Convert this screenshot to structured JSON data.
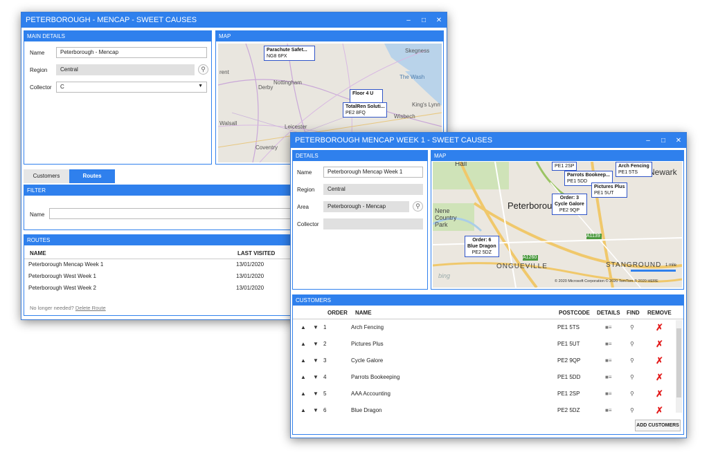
{
  "win1": {
    "title": "PETERBOROUGH - MENCAP - SWEET CAUSES",
    "main_details": {
      "header": "MAIN DETAILS",
      "name_label": "Name",
      "name_value": "Peterborough - Mencap",
      "region_label": "Region",
      "region_value": "Central",
      "collector_label": "Collector",
      "collector_value": "C"
    },
    "map": {
      "header": "MAP",
      "pins": [
        {
          "line1": "Parachute Safet...",
          "line2": "NG8 6PX"
        },
        {
          "line1": "Floor 4 U",
          "line2": ""
        },
        {
          "line1": "TotalRen Soluti...",
          "line2": "PE2 8FQ"
        }
      ],
      "places": [
        "Skegness",
        "rent",
        "Derby",
        "Nottingham",
        "The Wash",
        "King's Lynn",
        "Wisbech",
        "Walsall",
        "Leicester",
        "Coventry"
      ]
    },
    "tabs": [
      "Customers",
      "Routes"
    ],
    "filter": {
      "header": "FILTER",
      "name_label": "Name"
    },
    "routes": {
      "header": "ROUTES",
      "col_name": "NAME",
      "col_last": "LAST VISITED",
      "rows": [
        {
          "name": "Peterborough Mencap Week 1",
          "date": "13/01/2020"
        },
        {
          "name": "Peterborough West Week 1",
          "date": "13/01/2020"
        },
        {
          "name": "Peterborough West Week 2",
          "date": "13/01/2020"
        }
      ],
      "footer_text": "No longer needed?",
      "footer_link": "Delete Route"
    }
  },
  "win2": {
    "title": "PETERBOROUGH MENCAP WEEK 1 - SWEET CAUSES",
    "details": {
      "header": "DETAILS",
      "name_label": "Name",
      "name_value": "Peterborough Mencap Week 1",
      "region_label": "Region",
      "region_value": "Central",
      "area_label": "Area",
      "area_value": "Peterborough - Mencap",
      "collector_label": "Collector",
      "collector_value": ""
    },
    "map": {
      "header": "MAP",
      "pins": [
        {
          "line1": "PE1 2SP",
          "line2": ""
        },
        {
          "line1": "Parrots Bookeep...",
          "line2": "PE1 5DD"
        },
        {
          "line1": "Arch Fencing",
          "line2": "PE1 5TS"
        },
        {
          "line1": "Pictures Plus",
          "line2": "PE1 5UT"
        },
        {
          "line1": "Order: 3",
          "line2": "Cycle Galore",
          "line3": "PE2 9QP"
        },
        {
          "line1": "Order: 6",
          "line2": "Blue Dragon",
          "line3": "PE2 5DZ"
        }
      ],
      "places": [
        "Hall",
        "Newark",
        "Peterborough",
        "Nene Country Park",
        "ONGUEVILLE",
        "STANGROUND",
        "A1260",
        "A1139"
      ],
      "scale": "1 mile",
      "copyright": "© 2020 Microsoft Corporation  © 2020 TomTom © 2020 HERE",
      "logo": "bing"
    },
    "customers": {
      "header": "CUSTOMERS",
      "columns": {
        "order": "ORDER",
        "name": "NAME",
        "postcode": "POSTCODE",
        "details": "DETAILS",
        "find": "FIND",
        "remove": "REMOVE"
      },
      "rows": [
        {
          "order": "1",
          "name": "Arch Fencing",
          "postcode": "PE1 5TS"
        },
        {
          "order": "2",
          "name": "Pictures Plus",
          "postcode": "PE1 5UT"
        },
        {
          "order": "3",
          "name": "Cycle Galore",
          "postcode": "PE2 9QP"
        },
        {
          "order": "4",
          "name": "Parrots Bookeeping",
          "postcode": "PE1 5DD"
        },
        {
          "order": "5",
          "name": "AAA Accounting",
          "postcode": "PE1 2SP"
        },
        {
          "order": "6",
          "name": "Blue Dragon",
          "postcode": "PE2 5DZ"
        }
      ],
      "add_button": "ADD CUSTOMERS"
    }
  },
  "icons": {
    "minimize": "minimize-icon",
    "maximize": "maximize-icon",
    "close": "close-icon",
    "search": "search-icon"
  },
  "colors": {
    "accent": "#2f80ed",
    "remove": "#e31b1b",
    "map_pin": "#2f54c8"
  }
}
